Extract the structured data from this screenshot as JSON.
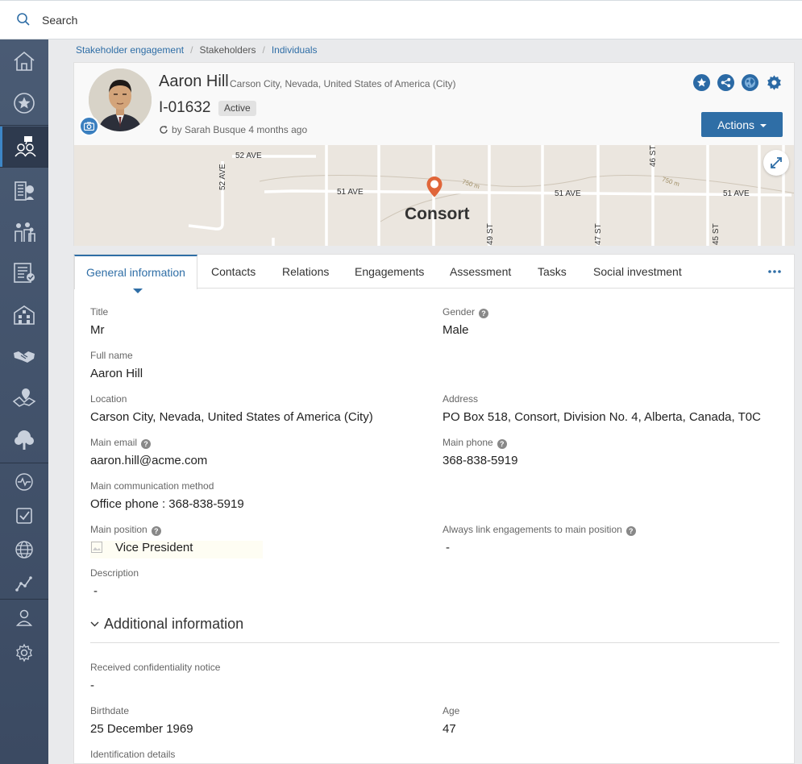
{
  "search": {
    "placeholder": "Search"
  },
  "sidebar": {
    "items": [
      {
        "name": "home-icon"
      },
      {
        "name": "star-icon"
      },
      {
        "name": "stakeholders-icon",
        "active": true
      },
      {
        "name": "organizations-icon"
      },
      {
        "name": "groups-icon"
      },
      {
        "name": "tasks-list-icon"
      },
      {
        "name": "buildings-icon"
      },
      {
        "name": "handshake-icon"
      },
      {
        "name": "map-pin-icon"
      },
      {
        "name": "tree-icon"
      },
      {
        "name": "activity-icon"
      },
      {
        "name": "checkbox-icon"
      },
      {
        "name": "globe-icon"
      },
      {
        "name": "chart-line-icon"
      },
      {
        "name": "user-icon"
      },
      {
        "name": "settings-icon"
      }
    ]
  },
  "breadcrumb": {
    "items": [
      "Stakeholder engagement",
      "Stakeholders",
      "Individuals"
    ],
    "separator": "/"
  },
  "header": {
    "name": "Aaron Hill",
    "location": "Carson City, Nevada, United States of America (City)",
    "id": "I-01632",
    "status": "Active",
    "byline": "by Sarah Busque 4 months ago",
    "actions_label": "Actions",
    "icons": [
      "favorite-star-icon",
      "share-icon",
      "globe-icon",
      "settings-icon"
    ]
  },
  "map": {
    "city": "Consort",
    "roads": {
      "r52ave_top": "52 AVE",
      "r52ave_vert": "52 AVE",
      "r51ave_a": "51 AVE",
      "r51ave_b": "51 AVE",
      "r51ave_c": "51 AVE",
      "r49st": "49 ST",
      "r47st": "47 ST",
      "r46st": "46 ST",
      "r45st": "45 ST",
      "r750a": "750 m",
      "r750b": "750 m"
    }
  },
  "tabs": [
    "General information",
    "Contacts",
    "Relations",
    "Engagements",
    "Assessment",
    "Tasks",
    "Social investment"
  ],
  "general": {
    "title_label": "Title",
    "title_value": "Mr",
    "gender_label": "Gender",
    "gender_value": "Male",
    "fullname_label": "Full name",
    "fullname_value": "Aaron Hill",
    "location_label": "Location",
    "location_value": "Carson City, Nevada, United States of America (City)",
    "address_label": "Address",
    "address_value": "PO Box 518, Consort, Division No. 4, Alberta, Canada, T0C",
    "email_label": "Main email",
    "email_value": "aaron.hill@acme.com",
    "phone_label": "Main phone",
    "phone_value": "368-838-5919",
    "comm_label": "Main communication method",
    "comm_value": "Office phone : 368-838-5919",
    "position_label": "Main position",
    "position_value": "Vice President",
    "alwayslink_label": "Always link engagements to main position",
    "alwayslink_value": "-",
    "description_label": "Description",
    "description_value": "-"
  },
  "additional": {
    "section_title": "Additional information",
    "conf_label": "Received confidentiality notice",
    "conf_value": "-",
    "birthdate_label": "Birthdate",
    "birthdate_value": "25 December 1969",
    "age_label": "Age",
    "age_value": "47",
    "ident_label": "Identification details"
  },
  "colors": {
    "accent": "#2f6ea6",
    "sidebar": "#44546c",
    "marker": "#e0663a"
  }
}
